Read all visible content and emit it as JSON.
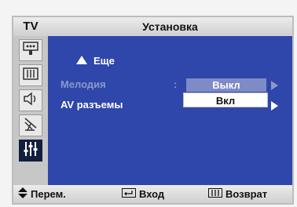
{
  "header": {
    "source_label": "TV",
    "menu_title": "Установка"
  },
  "sidebar": {
    "items": [
      {
        "icon": "picture-icon",
        "active": false
      },
      {
        "icon": "sound-icon",
        "active": false
      },
      {
        "icon": "speaker-icon",
        "active": false
      },
      {
        "icon": "antenna-icon",
        "active": false
      },
      {
        "icon": "setup-icon",
        "active": true
      }
    ]
  },
  "menu": {
    "more_label": "Еще",
    "melody_label": "Мелодия",
    "separator": ":",
    "av_label": "AV разъемы"
  },
  "dropdown": {
    "options": [
      "Выкл",
      "Вкл"
    ],
    "highlighted": "Вкл"
  },
  "footer": {
    "move_label": "Перем.",
    "enter_label": "Вход",
    "return_label": "Возврат"
  },
  "colors": {
    "content_bg": "#2f46ab",
    "active_icon_bg": "#131f3d",
    "dim_text": "#8c98c9",
    "dropdown_dim_bg": "#7f8bc6"
  }
}
